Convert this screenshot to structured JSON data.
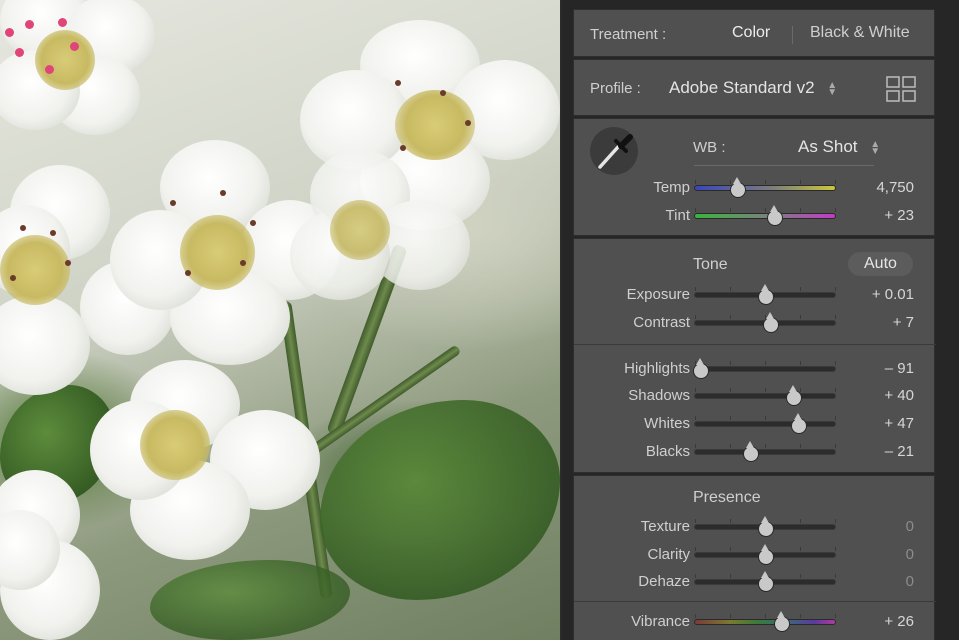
{
  "treatment": {
    "label": "Treatment :",
    "options": [
      "Color",
      "Black & White"
    ],
    "selected": "Color"
  },
  "profile": {
    "label": "Profile :",
    "value": "Adobe Standard v2",
    "browser_icon": "grid-icon"
  },
  "wb": {
    "picker_icon": "eyedropper-icon",
    "label": "WB :",
    "value": "As Shot",
    "sliders": [
      {
        "label": "Temp",
        "value": "4,750",
        "level": 0.3
      },
      {
        "label": "Tint",
        "value": "+ 23",
        "level": 0.56
      }
    ]
  },
  "tone": {
    "title": "Tone",
    "auto_label": "Auto",
    "sliders": [
      {
        "label": "Exposure",
        "value": "+ 0.01",
        "level": 0.5
      },
      {
        "label": "Contrast",
        "value": "+ 7",
        "level": 0.535
      }
    ],
    "sliders2": [
      {
        "label": "Highlights",
        "value": "– 91",
        "level": 0.045
      },
      {
        "label": "Shadows",
        "value": "+ 40",
        "level": 0.7
      },
      {
        "label": "Whites",
        "value": "+ 47",
        "level": 0.735
      },
      {
        "label": "Blacks",
        "value": "– 21",
        "level": 0.395
      }
    ]
  },
  "presence": {
    "title": "Presence",
    "sliders": [
      {
        "label": "Texture",
        "value": "0",
        "level": 0.5
      },
      {
        "label": "Clarity",
        "value": "0",
        "level": 0.5
      },
      {
        "label": "Dehaze",
        "value": "0",
        "level": 0.5
      }
    ],
    "vibrance": {
      "label": "Vibrance",
      "value": "+ 26",
      "level": 0.61
    }
  },
  "colors": {
    "panel_bg": "#505050",
    "text": "#cfcfcf",
    "thumb": "#c9c9c9"
  }
}
